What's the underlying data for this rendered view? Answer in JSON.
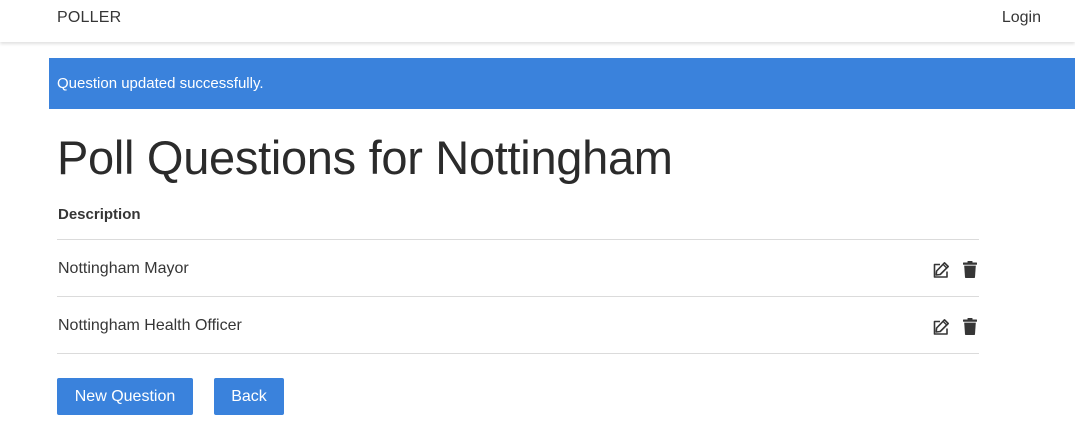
{
  "navbar": {
    "brand": "POLLER",
    "login_label": "Login"
  },
  "notification": {
    "message": "Question updated successfully."
  },
  "page": {
    "title": "Poll Questions for Nottingham"
  },
  "table": {
    "header": "Description",
    "rows": [
      {
        "description": "Nottingham Mayor"
      },
      {
        "description": "Nottingham Health Officer"
      }
    ],
    "row_icons": [
      "edit-icon",
      "trash-icon"
    ]
  },
  "buttons": {
    "new_question_label": "New Question",
    "back_label": "Back"
  },
  "colors": {
    "primary": "#3a82dc",
    "text": "#363636",
    "divider": "#dbdbdb"
  }
}
